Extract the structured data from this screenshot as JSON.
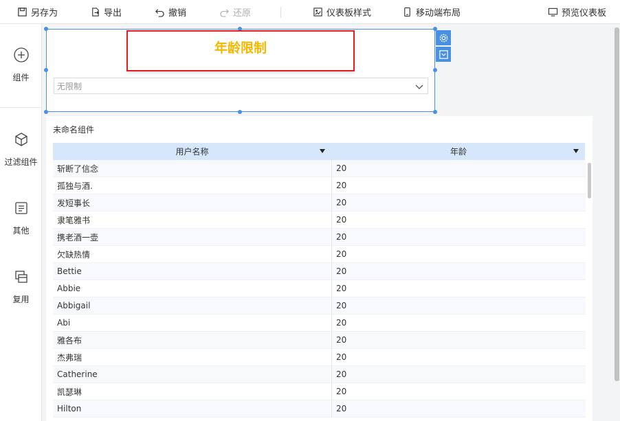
{
  "toolbar": {
    "save_as": "另存为",
    "export": "导出",
    "undo": "撤销",
    "redo": "还原",
    "dashboard_style": "仪表板样式",
    "mobile_layout": "移动端布局",
    "preview": "预览仪表板"
  },
  "sidebar": {
    "items": [
      {
        "label": "组件",
        "icon": "plus-circle-icon"
      },
      {
        "label": "过滤组件",
        "icon": "cube-icon"
      },
      {
        "label": "其他",
        "icon": "document-icon"
      },
      {
        "label": "复用",
        "icon": "layers-icon"
      }
    ]
  },
  "filter_widget": {
    "title": "年龄限制",
    "select_value": "无限制"
  },
  "table_widget": {
    "title": "未命名组件",
    "columns": [
      "用户名称",
      "年龄"
    ],
    "rows": [
      [
        "斩断了信念",
        "20"
      ],
      [
        "孤独与酒.",
        "20"
      ],
      [
        "发短事长",
        "20"
      ],
      [
        "隶笔雅书",
        "20"
      ],
      [
        "携老酒一壶",
        "20"
      ],
      [
        "欠缺热情",
        "20"
      ],
      [
        "Bettie",
        "20"
      ],
      [
        "Abbie",
        "20"
      ],
      [
        "Abbigail",
        "20"
      ],
      [
        "Abi",
        "20"
      ],
      [
        "雅各布",
        "20"
      ],
      [
        "杰弗瑞",
        "20"
      ],
      [
        "Catherine",
        "20"
      ],
      [
        "凯瑟琳",
        "20"
      ],
      [
        "Hilton",
        "20"
      ]
    ]
  },
  "colors": {
    "accent": "#4a90e2",
    "title_text": "#f5b800",
    "highlight_border": "#e02020",
    "table_header": "#d6e6fb"
  }
}
